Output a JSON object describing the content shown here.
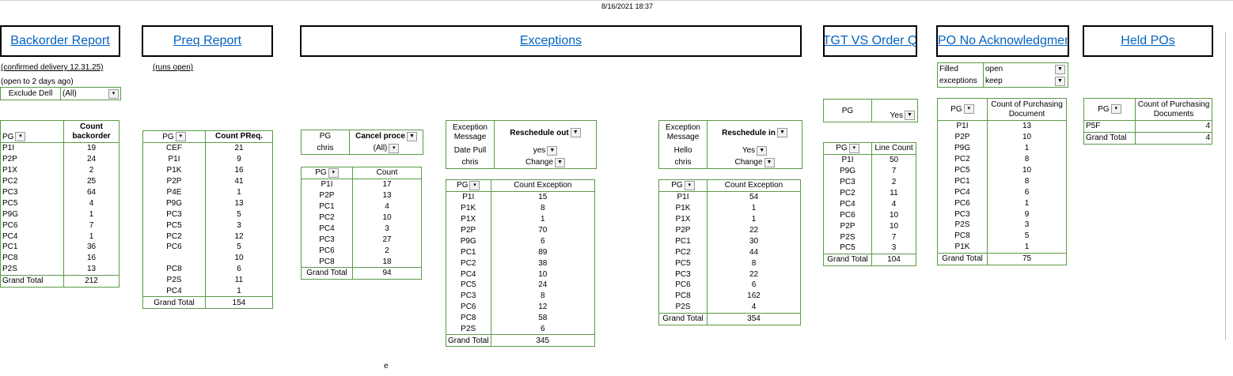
{
  "timestamp": "8/16/2021 18:37",
  "headers": {
    "backorder": "Backorder Report",
    "preq": "Preq Report ",
    "exceptions": "Exceptions",
    "tgt": "TGT VS Order Q",
    "po_ack": "PO No Acknowledgment",
    "held": "Held POs"
  },
  "backorder": {
    "note1": "(confirmed delivery 12.31.25)",
    "note2": "(open to 2 days ago)",
    "filter_label": "Exclude Dell",
    "filter_value": "(All)",
    "col1": "PG",
    "col2": "Count backorder",
    "rows": [
      [
        "P1I",
        "19"
      ],
      [
        "P2P",
        "24"
      ],
      [
        "P1X",
        "2"
      ],
      [
        "PC2",
        "25"
      ],
      [
        "PC3",
        "64"
      ],
      [
        "PC5",
        "4"
      ],
      [
        "P9G",
        "1"
      ],
      [
        "PC6",
        "7"
      ],
      [
        "PC4",
        "1"
      ],
      [
        "PC1",
        "36"
      ],
      [
        "PC8",
        "16"
      ],
      [
        "P2S",
        "13"
      ]
    ],
    "total_label": "Grand Total",
    "total": "212"
  },
  "preq": {
    "note": "(runs open)",
    "col1": "PG",
    "col2": "Count PReq.",
    "rows": [
      [
        "CEF",
        "21"
      ],
      [
        "P1I",
        "9"
      ],
      [
        "P1K",
        "16"
      ],
      [
        "P2P",
        "41"
      ],
      [
        "P4E",
        "1"
      ],
      [
        "P9G",
        "13"
      ],
      [
        "PC3",
        "5"
      ],
      [
        "PC5",
        "3"
      ],
      [
        "PC2",
        "12"
      ],
      [
        "PC6",
        "5"
      ],
      [
        "",
        "10"
      ],
      [
        "PC8",
        "6"
      ],
      [
        "P2S",
        "11"
      ],
      [
        "PC4",
        "1"
      ]
    ],
    "total_label": "Grand Total",
    "total": "154"
  },
  "cancel": {
    "f1_label": "PG",
    "f1_value": "Cancel proce",
    "f2_label": "chris",
    "f2_value": "(All)",
    "col1": "PG",
    "col2": "Count",
    "rows": [
      [
        "P1I",
        "17"
      ],
      [
        "P2P",
        "13"
      ],
      [
        "PC1",
        "4"
      ],
      [
        "PC2",
        "10"
      ],
      [
        "PC4",
        "3"
      ],
      [
        "PC3",
        "27"
      ],
      [
        "PC6",
        "2"
      ],
      [
        "PC8",
        "18"
      ]
    ],
    "total_label": "Grand Total",
    "total": "94"
  },
  "resched_out": {
    "f1_label": "Exception Message",
    "f1_value": "Reschedule out",
    "f2_label": "Date Pull",
    "f2_value": "yes",
    "f3_label": "chris",
    "f3_value": "Change",
    "col1": "PG",
    "col2": "Count Exception",
    "rows": [
      [
        "P1I",
        "15"
      ],
      [
        "P1K",
        "8"
      ],
      [
        "P1X",
        "1"
      ],
      [
        "P2P",
        "70"
      ],
      [
        "P9G",
        "6"
      ],
      [
        "PC1",
        "89"
      ],
      [
        "PC2",
        "38"
      ],
      [
        "PC4",
        "10"
      ],
      [
        "PC5",
        "24"
      ],
      [
        "PC3",
        "8"
      ],
      [
        "PC6",
        "12"
      ],
      [
        "PC8",
        "58"
      ],
      [
        "P2S",
        "6"
      ]
    ],
    "total_label": "Grand Total",
    "total": "345"
  },
  "resched_in": {
    "f1_label": "Exception Message",
    "f1_value": "Reschedule in",
    "f2_label": "Hello",
    "f2_value": "Yes",
    "f3_label": "chris",
    "f3_value": "Change",
    "col1": "PG",
    "col2": "Count Exception",
    "rows": [
      [
        "P1I",
        "54"
      ],
      [
        "P1K",
        "1"
      ],
      [
        "P1X",
        "1"
      ],
      [
        "P2P",
        "22"
      ],
      [
        "PC1",
        "30"
      ],
      [
        "PC2",
        "44"
      ],
      [
        "PC5",
        "8"
      ],
      [
        "PC3",
        "22"
      ],
      [
        "PC6",
        "6"
      ],
      [
        "PC8",
        "162"
      ],
      [
        "P2S",
        "4"
      ]
    ],
    "total_label": "Grand Total",
    "total": "354"
  },
  "tgt": {
    "f_label": "PG",
    "f_value": "Yes",
    "col1": "PG",
    "col2": "Line Count",
    "rows": [
      [
        "P1I",
        "50"
      ],
      [
        "P9G",
        "7"
      ],
      [
        "PC3",
        "2"
      ],
      [
        "PC2",
        "11"
      ],
      [
        "PC4",
        "4"
      ],
      [
        "PC6",
        "10"
      ],
      [
        "P2P",
        "10"
      ],
      [
        "P2S",
        "7"
      ],
      [
        "PC5",
        "3"
      ]
    ],
    "total_label": "Grand Total",
    "total": "104"
  },
  "po_ack": {
    "f1_label": "Filled",
    "f1_value": "open",
    "f2_label": "exceptions",
    "f2_value": "keep",
    "col1": "PG",
    "col2": "Count of Purchasing Document",
    "rows": [
      [
        "P1I",
        "13"
      ],
      [
        "P2P",
        "10"
      ],
      [
        "P9G",
        "1"
      ],
      [
        "PC2",
        "8"
      ],
      [
        "PC5",
        "10"
      ],
      [
        "PC1",
        "8"
      ],
      [
        "PC4",
        "6"
      ],
      [
        "PC6",
        "1"
      ],
      [
        "PC3",
        "9"
      ],
      [
        "P2S",
        "3"
      ],
      [
        "PC8",
        "5"
      ],
      [
        "P1K",
        "1"
      ]
    ],
    "total_label": "Grand Total",
    "total": "75"
  },
  "held": {
    "col1": "PG",
    "col2": "Count of Purchasing Documents",
    "rows": [
      [
        "P5F",
        "4"
      ]
    ],
    "total_label": "Grand Total",
    "total": "4"
  },
  "stray_text": "e"
}
